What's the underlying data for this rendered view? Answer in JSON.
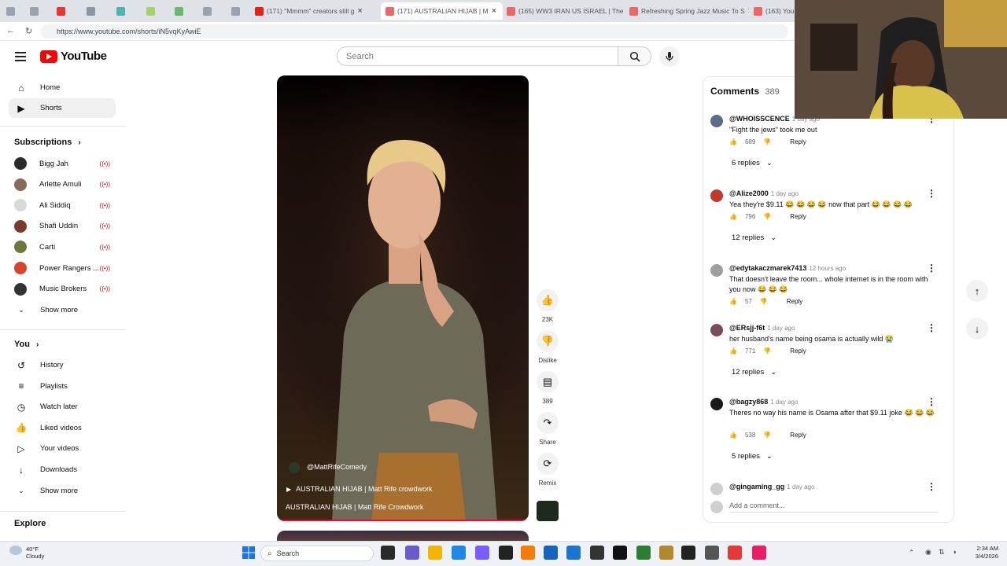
{
  "browser": {
    "tabs": [
      {
        "label": "",
        "color": "#9aa3ad"
      },
      {
        "label": "",
        "color": "#9aa3ad"
      },
      {
        "label": "",
        "color": "#e33"
      },
      {
        "label": "",
        "color": "#8b96a3"
      },
      {
        "label": "",
        "color": "#4db6ac"
      },
      {
        "label": "",
        "color": "#a5d36b"
      },
      {
        "label": "",
        "color": "#66bb6a"
      },
      {
        "label": "",
        "color": "#9aa3ad"
      },
      {
        "label": "",
        "color": "#9aa3ad"
      },
      {
        "label": "(171) \"Mmmm\" creators still g",
        "color": "#e62117"
      },
      {
        "label": "(171) AUSTRALIAN HIJAB | M",
        "color": "#e66"
      },
      {
        "label": "(165) WW3 IRAN US ISRAEL | The",
        "color": "#e66"
      },
      {
        "label": "Refreshing Spring Jazz Music To S",
        "color": "#e66"
      },
      {
        "label": "(163) You",
        "color": "#e66"
      }
    ],
    "url": "https://www.youtube.com/shorts/iN5vqKyAwiE"
  },
  "header": {
    "logo_text": "YouTube",
    "search_placeholder": "Search"
  },
  "sidebar": {
    "main": [
      {
        "label": "Home",
        "icon": "home-icon"
      },
      {
        "label": "Shorts",
        "icon": "shorts-icon"
      }
    ],
    "subscriptions_title": "Subscriptions",
    "subscriptions": [
      {
        "label": "Bigg Jah",
        "color": "#2b2b2b"
      },
      {
        "label": "Arlette Amuli",
        "color": "#8a6a55"
      },
      {
        "label": "Ali Siddiq",
        "color": "#d9d9d9"
      },
      {
        "label": "Shafi Uddin",
        "color": "#7a3b2e"
      },
      {
        "label": "Carti",
        "color": "#6b7a3a"
      },
      {
        "label": "Power Rangers ...",
        "color": "#d4452c"
      },
      {
        "label": "Music Brokers",
        "color": "#333333"
      }
    ],
    "show_more": "Show more",
    "you_title": "You",
    "you_items": [
      {
        "label": "History",
        "icon": "history-icon"
      },
      {
        "label": "Playlists",
        "icon": "playlists-icon"
      },
      {
        "label": "Watch later",
        "icon": "watch-later-icon"
      },
      {
        "label": "Liked videos",
        "icon": "liked-videos-icon"
      },
      {
        "label": "Your videos",
        "icon": "your-videos-icon"
      },
      {
        "label": "Downloads",
        "icon": "downloads-icon"
      }
    ],
    "show_more_2": "Show more",
    "explore_title": "Explore"
  },
  "video": {
    "channel": "@MattRifeComedy",
    "song": "AUSTRALIAN HIJAB | Matt Rife crowdwork",
    "title": "AUSTRALIAN HIJAB | Matt Rife Crowdwork",
    "actions": [
      {
        "label": "23K",
        "icon": "like-icon"
      },
      {
        "label": "Dislike",
        "icon": "dislike-icon"
      },
      {
        "label": "389",
        "icon": "comment-icon"
      },
      {
        "label": "Share",
        "icon": "share-icon"
      },
      {
        "label": "Remix",
        "icon": "remix-icon"
      }
    ]
  },
  "comments": {
    "title": "Comments",
    "count": "389",
    "items": [
      {
        "user": "@WHOISSCENCE",
        "time": "1 day ago",
        "text": "\"Fight the jews\" took me out",
        "likes": "689",
        "reply": "Reply",
        "replies": "6 replies",
        "color": "#5b6b8a"
      },
      {
        "user": "@Alize2000",
        "time": "1 day ago",
        "text": "Yea they're $9.11 😂 😂 😂 😂 now that part 😂 😂 😂 😂",
        "likes": "796",
        "reply": "Reply",
        "replies": "12 replies",
        "color": "#c0392b"
      },
      {
        "user": "@edytakaczmarek7413",
        "time": "12 hours ago",
        "text": "That doesn't leave the room... whole internet is in the room with you now 😂 😂 😂",
        "likes": "57",
        "reply": "Reply",
        "replies": "",
        "color": "#9e9e9e"
      },
      {
        "user": "@ERsjj-f6t",
        "time": "1 day ago",
        "text": "her husband's name being osama is actually wild 😭",
        "likes": "771",
        "reply": "Reply",
        "replies": "12 replies",
        "color": "#7d4a5a"
      },
      {
        "user": "@bagzy868",
        "time": "1 day ago",
        "text": "Theres no way his name is Osama after that $9.11 joke 😂 😂 😂",
        "likes": "538",
        "reply": "Reply",
        "replies": "5 replies",
        "color": "#1a1a1a"
      },
      {
        "user": "@gingaming_gg",
        "time": "1 day ago",
        "text": "",
        "likes": "",
        "reply": "",
        "replies": "",
        "color": "#cfcfcf"
      }
    ],
    "add_placeholder": "Add a comment..."
  },
  "taskbar": {
    "weather_temp": "40°F",
    "weather_desc": "Cloudy",
    "search": "Search",
    "time": "2:34 AM",
    "date": "3/4/2026"
  }
}
